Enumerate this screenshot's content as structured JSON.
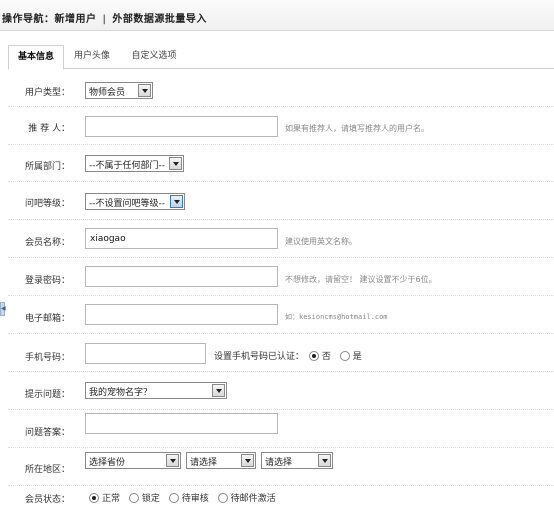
{
  "nav": {
    "prefix": "操作导航：",
    "current": "新增用户",
    "separator": "|",
    "import_link": "外部数据源批量导入"
  },
  "tabs": [
    {
      "label": "基本信息",
      "active": true
    },
    {
      "label": "用户头像",
      "active": false
    },
    {
      "label": "自定义选项",
      "active": false
    }
  ],
  "form": {
    "user_type": {
      "label": "用户类型：",
      "value": "物师会员"
    },
    "referrer": {
      "label": "推 荐 人：",
      "value": "",
      "hint": "如果有推荐人，请填写推荐人的用户名。"
    },
    "department": {
      "label": "所属部门：",
      "value": "--不属于任何部门--"
    },
    "wenba_level": {
      "label": "问吧等级：",
      "value": "--不设置问吧等级--"
    },
    "member_name": {
      "label": "会员名称：",
      "value": "xiaogao",
      "hint": "建议使用英文名称。"
    },
    "password": {
      "label": "登录密码：",
      "value": "",
      "hint": "不想修改，请留空！ 建议设置不少于6位。"
    },
    "email": {
      "label": "电子邮箱：",
      "value": "",
      "hint": "如：kesioncms@hotmail.com"
    },
    "mobile": {
      "label": "手机号码：",
      "value": "",
      "verify_label": "设置手机号码已认证：",
      "options": [
        {
          "label": "否",
          "checked": true
        },
        {
          "label": "是",
          "checked": false
        }
      ]
    },
    "question": {
      "label": "提示问题：",
      "value": "我的宠物名字？"
    },
    "answer": {
      "label": "问题答案：",
      "value": ""
    },
    "region": {
      "label": "所在地区：",
      "province": "选择省份",
      "city": "请选择",
      "district": "请选择"
    },
    "status": {
      "label": "会员状态：",
      "options": [
        {
          "label": "正常",
          "checked": true
        },
        {
          "label": "锁定",
          "checked": false
        },
        {
          "label": "待审核",
          "checked": false
        },
        {
          "label": "待邮件激活",
          "checked": false
        }
      ]
    }
  }
}
